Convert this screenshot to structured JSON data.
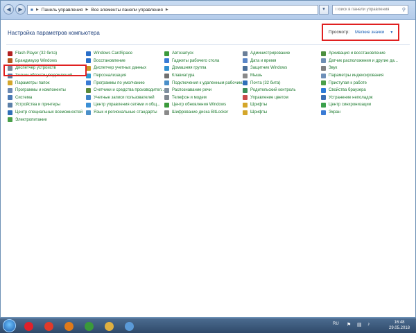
{
  "address": {
    "crumbs": [
      "Панель управления",
      "Все элементы панели управления"
    ]
  },
  "search": {
    "placeholder": "Поиск в панели управления"
  },
  "header": {
    "title": "Настройка параметров компьютера"
  },
  "view": {
    "label": "Просмотр:",
    "value": "Мелкие значки"
  },
  "items": [
    {
      "label": "Flash Player (32 бита)",
      "color": "#b32020"
    },
    {
      "label": "Windows CardSpace",
      "color": "#2a6fc9"
    },
    {
      "label": "Автозапуск",
      "color": "#3b9a3b"
    },
    {
      "label": "Администрирование",
      "color": "#6a7f99"
    },
    {
      "label": "Архивация и восстановление",
      "color": "#4c8f3f"
    },
    {
      "label": "Брандмауэр Windows",
      "color": "#b55a1f"
    },
    {
      "label": "Восстановление",
      "color": "#2a6fc9"
    },
    {
      "label": "Гаджеты рабочего стола",
      "color": "#3a7bd5"
    },
    {
      "label": "Дата и время",
      "color": "#5b86c7"
    },
    {
      "label": "Датчик расположения и другие да...",
      "color": "#6f8fb3"
    },
    {
      "label": "Диспетчер устройств",
      "color": "#7a8a9a"
    },
    {
      "label": "Диспетчер учетных данных",
      "color": "#c79a2a"
    },
    {
      "label": "Домашняя группа",
      "color": "#2f8fd0"
    },
    {
      "label": "Защитник Windows",
      "color": "#4a6e99"
    },
    {
      "label": "Звук",
      "color": "#808080"
    },
    {
      "label": "Значки области уведомлений",
      "color": "#5d7fa6"
    },
    {
      "label": "Персонализация",
      "color": "#2a9ad4"
    },
    {
      "label": "Клавиатура",
      "color": "#707070"
    },
    {
      "label": "Мышь",
      "color": "#8a8a8a"
    },
    {
      "label": "Параметры индексирования",
      "color": "#6d8fb8"
    },
    {
      "label": "Параметры папок",
      "color": "#d4a62a"
    },
    {
      "label": "Программы по умолчанию",
      "color": "#3a7bd5"
    },
    {
      "label": "Подключения к удаленным рабочим...",
      "color": "#4a8fc9"
    },
    {
      "label": "Почта (32 бита)",
      "color": "#2f6fb8"
    },
    {
      "label": "Приступая к работе",
      "color": "#4aa04a"
    },
    {
      "label": "Программы и компоненты",
      "color": "#6a89b3"
    },
    {
      "label": "Счетчики и средства производител...",
      "color": "#5a8a3a"
    },
    {
      "label": "Распознавание речи",
      "color": "#7f8f9f"
    },
    {
      "label": "Родительский контроль",
      "color": "#3b8f5a"
    },
    {
      "label": "Свойства браузера",
      "color": "#2b7bd8"
    },
    {
      "label": "Система",
      "color": "#4a7ab5"
    },
    {
      "label": "Учетные записи пользователей",
      "color": "#3f84c9"
    },
    {
      "label": "Телефон и модем",
      "color": "#808890"
    },
    {
      "label": "Управление цветом",
      "color": "#c94a4a"
    },
    {
      "label": "Устранение неполадок",
      "color": "#3a6fb5"
    },
    {
      "label": "Устройства и принтеры",
      "color": "#5a7fa8"
    },
    {
      "label": "Центр управления сетями и общ...",
      "color": "#3a8fd5"
    },
    {
      "label": "Центр обновления Windows",
      "color": "#3b9a3b"
    },
    {
      "label": "Шрифты",
      "color": "#d4a62a"
    },
    {
      "label": "Центр синхронизации",
      "color": "#3aa04a"
    },
    {
      "label": "Центр специальных возможностей",
      "color": "#2f6fb8"
    },
    {
      "label": "Язык и региональные стандарты",
      "color": "#4a8fc9"
    },
    {
      "label": "Шифрование диска BitLocker",
      "color": "#8a8a8a"
    },
    {
      "label": "Шрифты",
      "color": "#d4a62a"
    },
    {
      "label": "Экран",
      "color": "#3a7bd5"
    },
    {
      "label": "Электропитание",
      "color": "#4aa04a"
    }
  ],
  "taskbar": {
    "lang": "RU",
    "time": "16:48",
    "date": "29.05.2018",
    "apps": [
      {
        "name": "opera",
        "color": "#e0202a"
      },
      {
        "name": "yandex",
        "color": "#e03a2a"
      },
      {
        "name": "firefox",
        "color": "#e07a1a"
      },
      {
        "name": "chrome",
        "color": "#3a9a3a"
      },
      {
        "name": "explorer",
        "color": "#e0b040"
      },
      {
        "name": "control-panel",
        "color": "#5a9ad8"
      }
    ]
  }
}
